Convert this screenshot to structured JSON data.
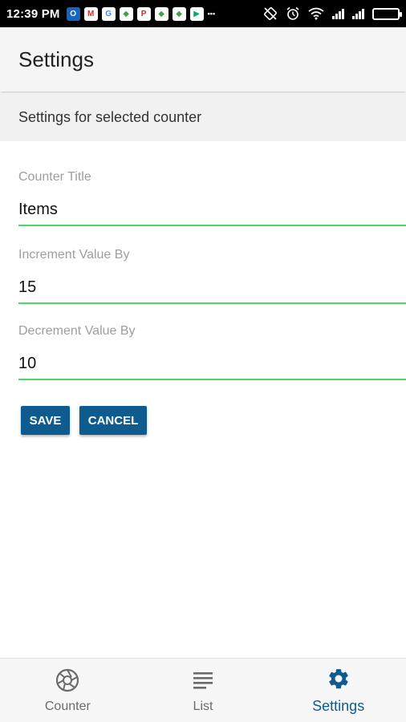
{
  "status_bar": {
    "time": "12:39 PM",
    "notification_icons": [
      {
        "name": "outlook-icon",
        "color": "#1565c0",
        "glyph": "O"
      },
      {
        "name": "gmail-icon",
        "color": "#d32f2f",
        "glyph": "M"
      },
      {
        "name": "google-icon",
        "color": "#ffffff",
        "glyph": "G"
      },
      {
        "name": "maps-icon",
        "color": "#43a047",
        "glyph": "◆"
      },
      {
        "name": "pinterest-icon",
        "color": "#c62828",
        "glyph": "P"
      },
      {
        "name": "maps-icon",
        "color": "#43a047",
        "glyph": "◆"
      },
      {
        "name": "maps-icon",
        "color": "#43a047",
        "glyph": "◆"
      },
      {
        "name": "play-store-icon",
        "color": "#00a86b",
        "glyph": "▶"
      },
      {
        "name": "more-dots-icon",
        "color": "#000000",
        "glyph": "•••"
      }
    ],
    "system_icons": [
      "rotate-icon",
      "alarm-icon",
      "wifi-icon",
      "signal-icon",
      "signal-icon",
      "battery-icon"
    ]
  },
  "app_bar": {
    "title": "Settings"
  },
  "section": {
    "header": "Settings for selected counter"
  },
  "form": {
    "counter_title": {
      "label": "Counter Title",
      "value": "Items"
    },
    "increment": {
      "label": "Increment Value By",
      "value": "15"
    },
    "decrement": {
      "label": "Decrement Value By",
      "value": "10"
    },
    "accent_color": "#4cd964"
  },
  "buttons": {
    "save": "SAVE",
    "cancel": "CANCEL",
    "color": "#0e5c8f"
  },
  "bottom_nav": {
    "items": [
      {
        "label": "Counter",
        "icon": "shutter-icon",
        "active": false
      },
      {
        "label": "List",
        "icon": "list-lines-icon",
        "active": false
      },
      {
        "label": "Settings",
        "icon": "gear-icon",
        "active": true
      }
    ],
    "active_color": "#0e5c8f",
    "inactive_color": "#6b6b6b"
  }
}
